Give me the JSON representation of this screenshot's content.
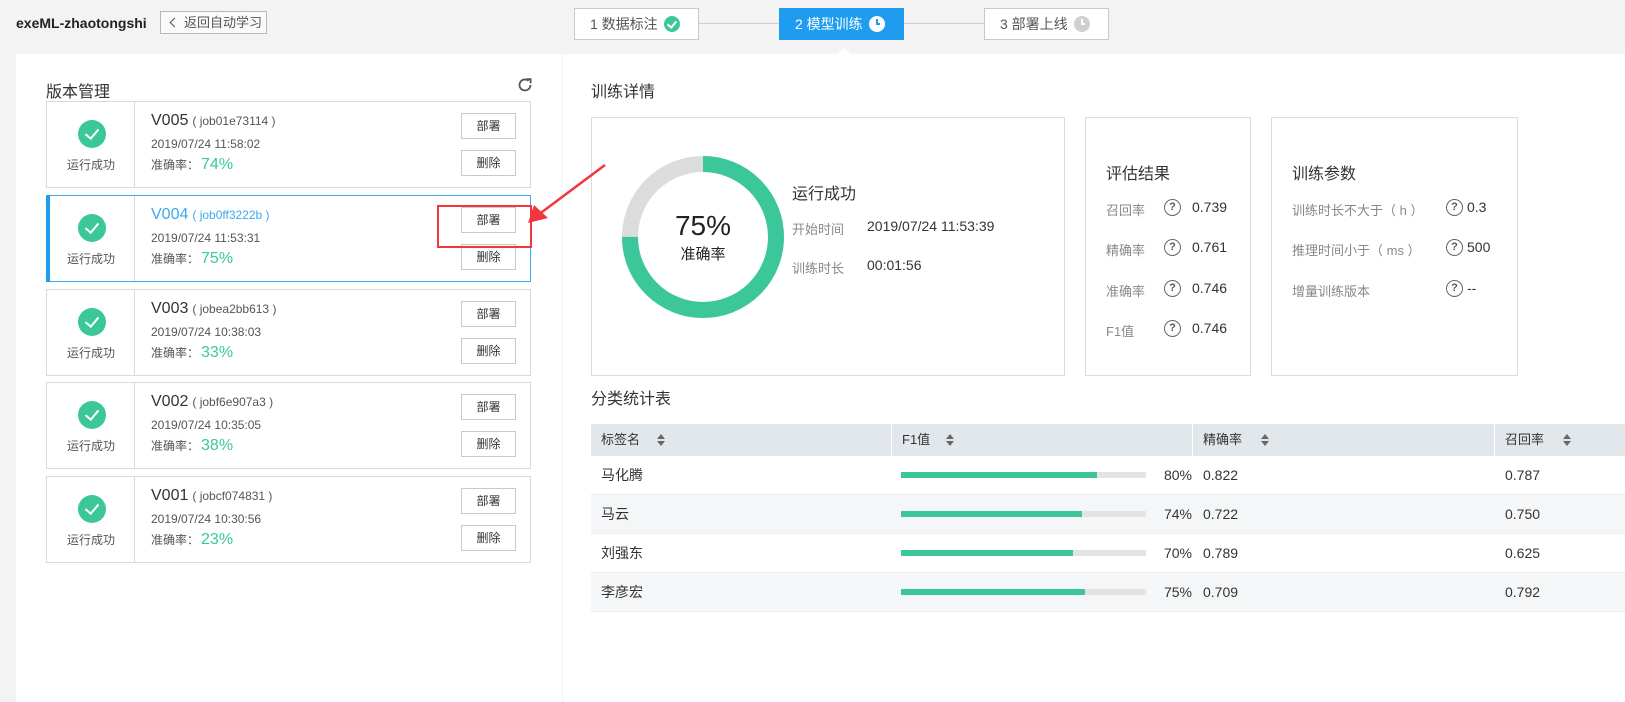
{
  "app": {
    "title": "exeML-zhaotongshi",
    "back_label": "返回自动学习"
  },
  "steps": [
    {
      "label": "1 数据标注",
      "state": "done"
    },
    {
      "label": "2 模型训练",
      "state": "active"
    },
    {
      "label": "3 部署上线",
      "state": "pending"
    }
  ],
  "version_panel": {
    "title": "版本管理",
    "versions": [
      {
        "version": "V005",
        "job": "( job01e73114 )",
        "date": "2019/07/24 11:58:02",
        "acc_label": "准确率：",
        "acc": "74%",
        "status": "运行成功",
        "deploy": "部署",
        "delete": "删除",
        "selected": false
      },
      {
        "version": "V004",
        "job": "( job0ff3222b )",
        "date": "2019/07/24 11:53:31",
        "acc_label": "准确率：",
        "acc": "75%",
        "status": "运行成功",
        "deploy": "部署",
        "delete": "删除",
        "selected": true
      },
      {
        "version": "V003",
        "job": "( jobea2bb613 )",
        "date": "2019/07/24 10:38:03",
        "acc_label": "准确率：",
        "acc": "33%",
        "status": "运行成功",
        "deploy": "部署",
        "delete": "删除",
        "selected": false
      },
      {
        "version": "V002",
        "job": "( jobf6e907a3 )",
        "date": "2019/07/24 10:35:05",
        "acc_label": "准确率：",
        "acc": "38%",
        "status": "运行成功",
        "deploy": "部署",
        "delete": "删除",
        "selected": false
      },
      {
        "version": "V001",
        "job": "( jobcf074831 )",
        "date": "2019/07/24 10:30:56",
        "acc_label": "准确率：",
        "acc": "23%",
        "status": "运行成功",
        "deploy": "部署",
        "delete": "删除",
        "selected": false
      }
    ]
  },
  "training": {
    "title": "训练详情",
    "accuracy_pct": "75%",
    "accuracy_value": 0.75,
    "accuracy_label": "准确率",
    "status": "运行成功",
    "start_label": "开始时间",
    "start_value": "2019/07/24 11:53:39",
    "duration_label": "训练时长",
    "duration_value": "00:01:56"
  },
  "evaluation": {
    "title": "评估结果",
    "metrics": [
      {
        "name": "召回率",
        "value": "0.739"
      },
      {
        "name": "精确率",
        "value": "0.761"
      },
      {
        "name": "准确率",
        "value": "0.746"
      },
      {
        "name": "F1值",
        "value": "0.746"
      }
    ]
  },
  "params": {
    "title": "训练参数",
    "items": [
      {
        "name": "训练时长不大于（ h ）",
        "value": "0.3"
      },
      {
        "name": "推理时间小于（ ms ）",
        "value": "500"
      },
      {
        "name": "增量训练版本",
        "value": "--"
      }
    ]
  },
  "class_table": {
    "title": "分类统计表",
    "columns": [
      "标签名",
      "F1值",
      "精确率",
      "召回率"
    ],
    "rows": [
      {
        "label": "马化腾",
        "f1_pct": "80%",
        "f1_value": 0.8,
        "precision": "0.822",
        "recall": "0.787"
      },
      {
        "label": "马云",
        "f1_pct": "74%",
        "f1_value": 0.74,
        "precision": "0.722",
        "recall": "0.750"
      },
      {
        "label": "刘强东",
        "f1_pct": "70%",
        "f1_value": 0.7,
        "precision": "0.789",
        "recall": "0.625"
      },
      {
        "label": "李彦宏",
        "f1_pct": "75%",
        "f1_value": 0.75,
        "precision": "0.709",
        "recall": "0.792"
      }
    ]
  },
  "colors": {
    "accent": "#1f9cf0",
    "success": "#3cc79b",
    "annotation": "#f2373c"
  },
  "icons": {
    "refresh": "refresh-icon",
    "help": "help-icon",
    "back": "chevron-left-icon",
    "sort": "sort-icon"
  }
}
